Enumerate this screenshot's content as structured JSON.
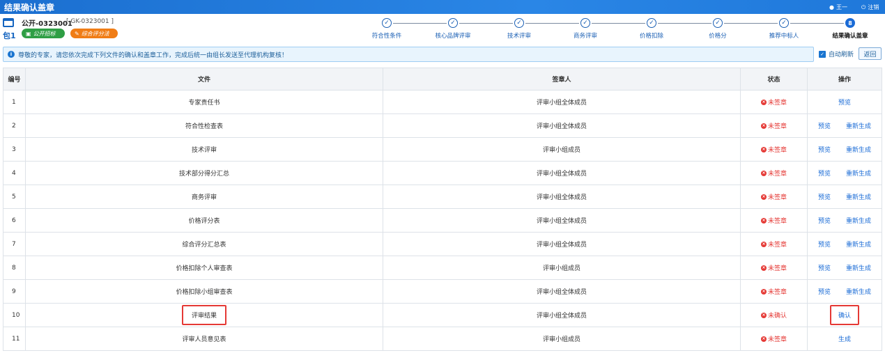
{
  "titlebar": {
    "title": "结果确认盖章",
    "user": "王一",
    "logout": "注销"
  },
  "project": {
    "package": "包1",
    "name": "公开-0323001",
    "code": "[ GK-0323001 ]",
    "tag1": "公开招标",
    "tag2": "综合评分法"
  },
  "steps": [
    {
      "label": "符合性条件",
      "state": "done"
    },
    {
      "label": "核心品牌评审",
      "state": "done"
    },
    {
      "label": "技术评审",
      "state": "done"
    },
    {
      "label": "商务评审",
      "state": "done"
    },
    {
      "label": "价格扣除",
      "state": "done"
    },
    {
      "label": "价格分",
      "state": "done"
    },
    {
      "label": "推荐中标人",
      "state": "done"
    },
    {
      "label": "结果确认盖章",
      "state": "active",
      "number": "8"
    }
  ],
  "notice": "尊敬的专家，请您依次完成下列文件的确认和盖章工作，完成后统一由组长发送至代理机构复核！",
  "auto_refresh": "自动刷新",
  "back": "返回",
  "colors": {
    "primary": "#1a6bd6",
    "danger": "#e53935",
    "tag_green": "#2e9e44",
    "tag_orange": "#f07d16"
  },
  "table": {
    "headers": [
      "编号",
      "文件",
      "签章人",
      "状态",
      "操作"
    ],
    "rows": [
      {
        "no": "1",
        "file": "专家责任书",
        "signer": "评审小组全体成员",
        "status": "未签章",
        "ops": [
          "预览"
        ]
      },
      {
        "no": "2",
        "file": "符合性检查表",
        "signer": "评审小组全体成员",
        "status": "未签章",
        "ops": [
          "预览",
          "重新生成"
        ]
      },
      {
        "no": "3",
        "file": "技术评审",
        "signer": "评审小组成员",
        "status": "未签章",
        "ops": [
          "预览",
          "重新生成"
        ]
      },
      {
        "no": "4",
        "file": "技术部分得分汇总",
        "signer": "评审小组全体成员",
        "status": "未签章",
        "ops": [
          "预览",
          "重新生成"
        ]
      },
      {
        "no": "5",
        "file": "商务评审",
        "signer": "评审小组全体成员",
        "status": "未签章",
        "ops": [
          "预览",
          "重新生成"
        ]
      },
      {
        "no": "6",
        "file": "价格评分表",
        "signer": "评审小组全体成员",
        "status": "未签章",
        "ops": [
          "预览",
          "重新生成"
        ]
      },
      {
        "no": "7",
        "file": "综合评分汇总表",
        "signer": "评审小组全体成员",
        "status": "未签章",
        "ops": [
          "预览",
          "重新生成"
        ]
      },
      {
        "no": "8",
        "file": "价格扣除个人审查表",
        "signer": "评审小组成员",
        "status": "未签章",
        "ops": [
          "预览",
          "重新生成"
        ]
      },
      {
        "no": "9",
        "file": "价格扣除小组审查表",
        "signer": "评审小组全体成员",
        "status": "未签章",
        "ops": [
          "预览",
          "重新生成"
        ]
      },
      {
        "no": "10",
        "file": "评审结果",
        "signer": "评审小组全体成员",
        "status": "未确认",
        "ops": [
          "确认"
        ],
        "highlight": true
      },
      {
        "no": "11",
        "file": "评审人员意见表",
        "signer": "评审小组成员",
        "status": "未签章",
        "ops": [
          "生成"
        ]
      }
    ]
  }
}
